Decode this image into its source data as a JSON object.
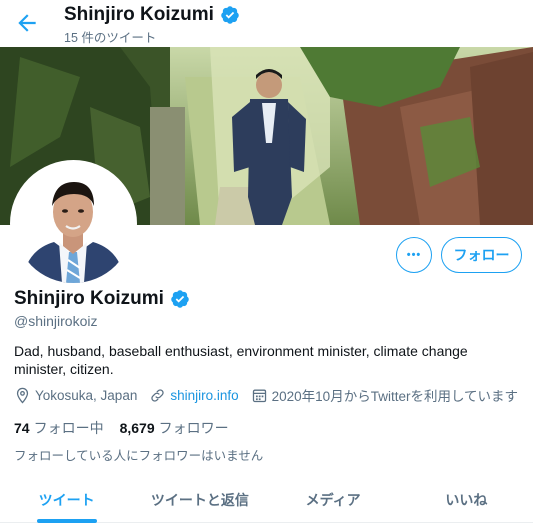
{
  "header": {
    "name": "Shinjiro Koizumi",
    "tweet_count": "15 件のツイート"
  },
  "profile": {
    "name": "Shinjiro Koizumi",
    "handle": "@shinjirokoiz",
    "bio": "Dad, husband, baseball enthusiast, environment minister, climate change minister, citizen.",
    "location": "Yokosuka, Japan",
    "website": "shinjiro.info",
    "joined": "2020年10月からTwitterを利用しています",
    "following_count": "74",
    "following_label": "フォロー中",
    "followers_count": "8,679",
    "followers_label": "フォロワー",
    "no_followers_text": "フォローしている人にフォロワーはいません"
  },
  "actions": {
    "more_label": "•••",
    "follow_label": "フォロー"
  },
  "tabs": [
    {
      "label": "ツイート"
    },
    {
      "label": "ツイートと返信"
    },
    {
      "label": "メディア"
    },
    {
      "label": "いいね"
    }
  ],
  "colors": {
    "accent": "#1da1f2",
    "secondary_text": "#5b7083",
    "link": "#1b95e0"
  },
  "icons": {
    "back": "arrow-left-icon",
    "verified": "verified-badge-icon",
    "location": "location-pin-icon",
    "link": "link-icon",
    "calendar": "calendar-icon"
  }
}
